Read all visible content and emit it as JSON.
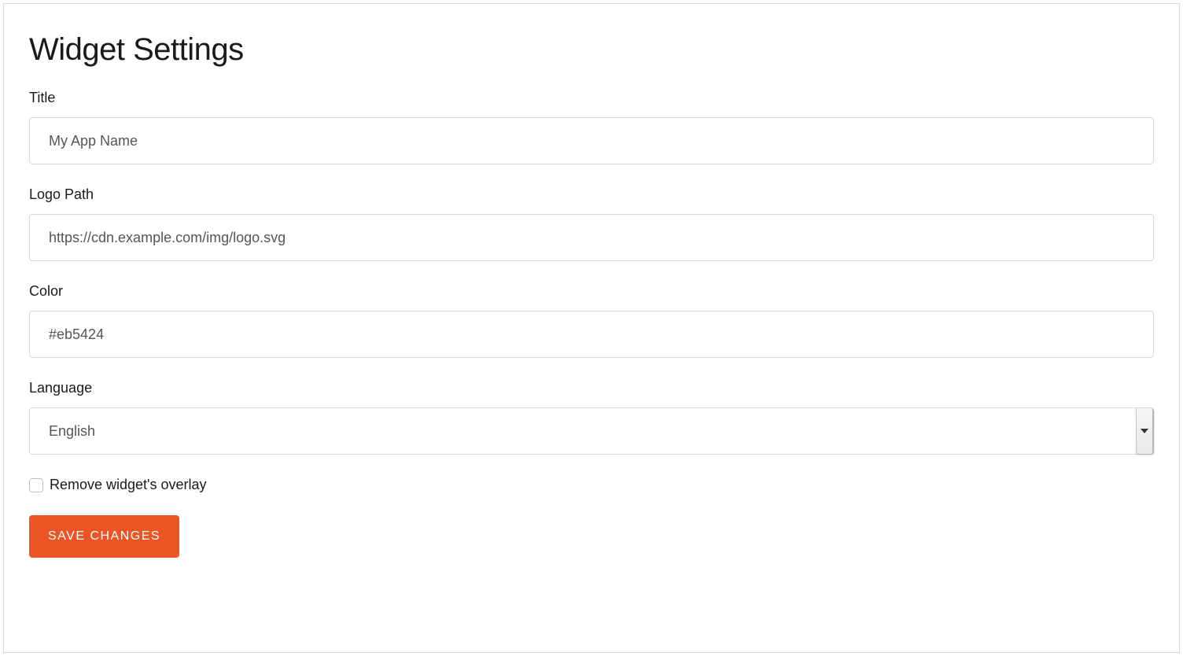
{
  "page_title": "Widget Settings",
  "fields": {
    "title": {
      "label": "Title",
      "placeholder": "My App Name",
      "value": ""
    },
    "logo_path": {
      "label": "Logo Path",
      "placeholder": "https://cdn.example.com/img/logo.svg",
      "value": ""
    },
    "color": {
      "label": "Color",
      "placeholder": "#eb5424",
      "value": ""
    },
    "language": {
      "label": "Language",
      "selected": "English"
    },
    "remove_overlay": {
      "label": "Remove widget's overlay",
      "checked": false
    }
  },
  "buttons": {
    "save": "SAVE CHANGES"
  },
  "colors": {
    "accent": "#eb5424"
  }
}
